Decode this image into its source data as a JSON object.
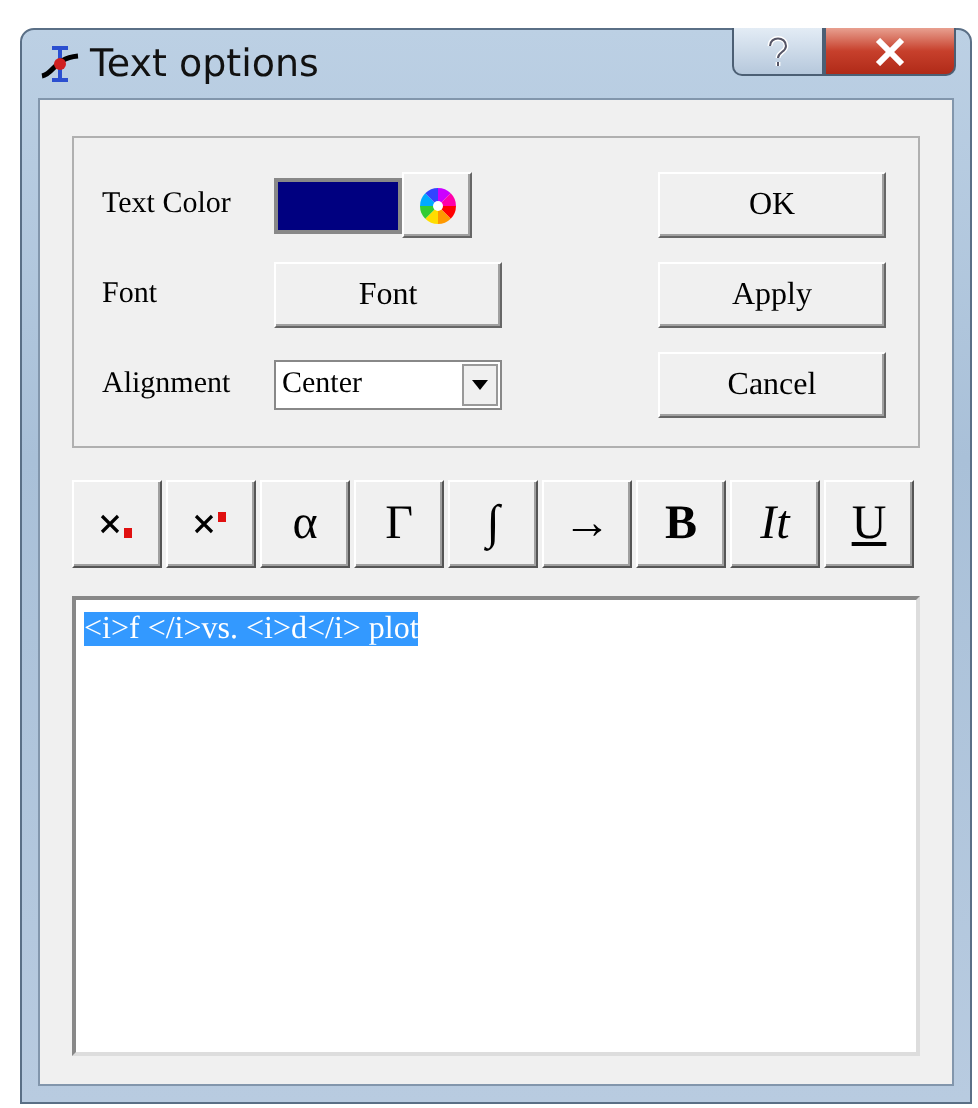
{
  "window": {
    "title": "Text options"
  },
  "options": {
    "text_color": {
      "label": "Text Color",
      "color": "#000080"
    },
    "font": {
      "label": "Font",
      "button": "Font"
    },
    "alignment": {
      "label": "Alignment",
      "value": "Center"
    }
  },
  "actions": [
    "OK",
    "Apply",
    "Cancel"
  ],
  "toolbar": [
    {
      "kind": "subscript"
    },
    {
      "kind": "superscript"
    },
    {
      "kind": "plain",
      "label": "α"
    },
    {
      "kind": "plain",
      "label": "Γ"
    },
    {
      "kind": "plain",
      "label": "∫"
    },
    {
      "kind": "plain",
      "label": "→"
    },
    {
      "kind": "bold",
      "label": "B"
    },
    {
      "kind": "italic",
      "label": "It"
    },
    {
      "kind": "underline",
      "label": "U"
    }
  ],
  "editor": {
    "text": "<i>f </i>vs. <i>d</i> plot",
    "selected": true
  }
}
